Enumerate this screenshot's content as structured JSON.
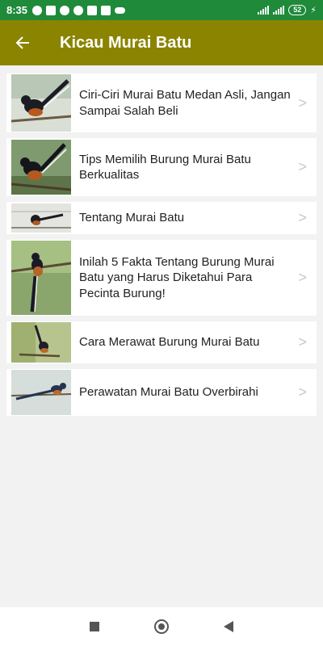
{
  "status_bar": {
    "time": "8:35",
    "battery": "52",
    "left_icons": [
      "facebook-icon",
      "instagram-icon",
      "app-icon",
      "p-icon",
      "trash-icon",
      "hand-icon",
      "cloud-icon"
    ]
  },
  "app_bar": {
    "title": "Kicau Murai Batu",
    "back_icon": "arrow-left-icon"
  },
  "articles": [
    {
      "title": "Ciri-Ciri Murai Batu Medan Asli, Jangan Sampai Salah Beli"
    },
    {
      "title": "Tips Memilih Burung Murai Batu Berkualitas"
    },
    {
      "title": "Tentang Murai Batu"
    },
    {
      "title": "Inilah 5 Fakta Tentang Burung Murai Batu yang Harus Diketahui Para Pecinta Burung!"
    },
    {
      "title": "Cara Merawat Burung Murai Batu"
    },
    {
      "title": "Perawatan Murai Batu Overbirahi"
    }
  ],
  "chevron": ">",
  "colors": {
    "status_bar": "#1e8a3a",
    "app_bar": "#8b8400",
    "background": "#f2f2f2"
  },
  "nav_bar": {
    "icons": [
      "recents-icon",
      "home-icon",
      "back-icon"
    ]
  }
}
